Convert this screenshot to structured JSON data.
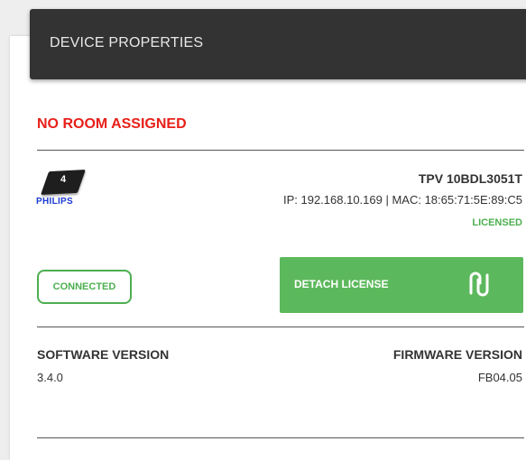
{
  "header": {
    "title": "DEVICE PROPERTIES"
  },
  "room": {
    "status": "NO ROOM ASSIGNED",
    "color": "#e8201a"
  },
  "device": {
    "logo_number": "4",
    "brand": "PHILIPS",
    "model": "TPV 10BDL3051T",
    "network": "IP: 192.168.10.169 | MAC: 18:65:71:5E:89:C5",
    "license_status": "LICENSED"
  },
  "status": {
    "connected_label": "CONNECTED",
    "color": "#4caf50"
  },
  "actions": {
    "detach_label": "DETACH LICENSE",
    "detach_icon": "unlink-icon",
    "accent": "#5cb85c"
  },
  "versions": {
    "software_label": "SOFTWARE VERSION",
    "software_value": "3.4.0",
    "firmware_label": "FIRMWARE VERSION",
    "firmware_value": "FB04.05"
  }
}
